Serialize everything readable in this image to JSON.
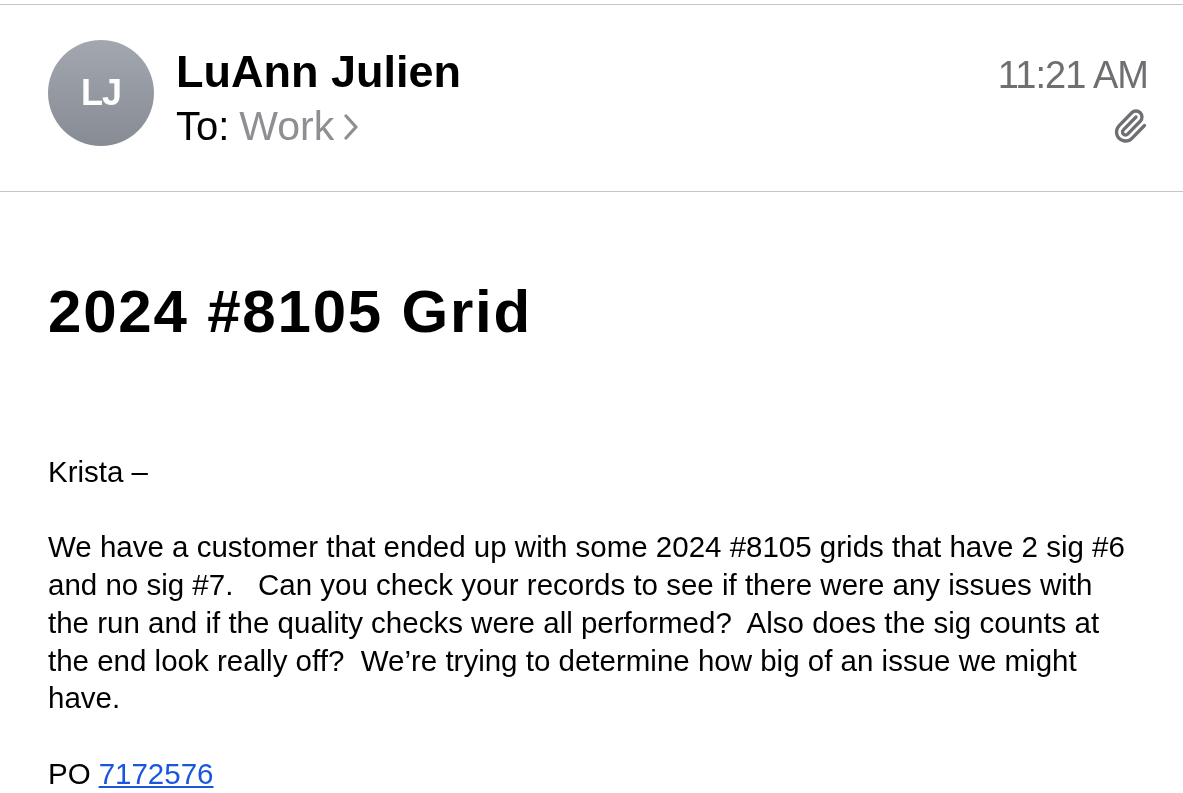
{
  "message_header": {
    "avatar_initials": "LJ",
    "sender_name": "LuAnn Julien",
    "to_label": "To:",
    "recipient": "Work",
    "time": "11:21 AM",
    "has_attachment": true
  },
  "subject": "2024 #8105 Grid",
  "body": {
    "greeting": "Krista –",
    "paragraph": "We have a customer that ended up with some 2024 #8105 grids that have 2 sig #6 and no sig #7.   Can you check your records to see if there were any issues with the run and if the quality checks were all performed?  Also does the sig counts at the end look really off?  We’re trying to determine how big of an issue we might have.",
    "po_label": "PO",
    "po_number": "7172576"
  }
}
